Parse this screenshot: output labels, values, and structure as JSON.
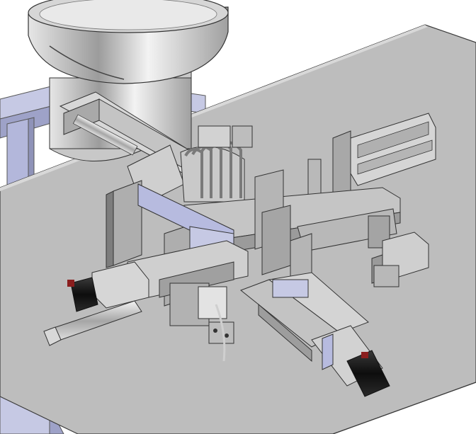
{
  "scene": {
    "description_name": "cad-assembly-render",
    "colors": {
      "background": "#ffffff",
      "table_top": "#bcbcbc",
      "table_edge": "#8e8e8e",
      "frame_blue": "#c6c9e4",
      "frame_blue_dark": "#8f93b8",
      "metal_light": "#dcdcdc",
      "metal_mid": "#a9a9a9",
      "metal_dark": "#5e5e5e",
      "motor_black": "#1c1c1c",
      "outline": "#2a2a2a",
      "accent_blue": "#9aa0d8"
    }
  }
}
